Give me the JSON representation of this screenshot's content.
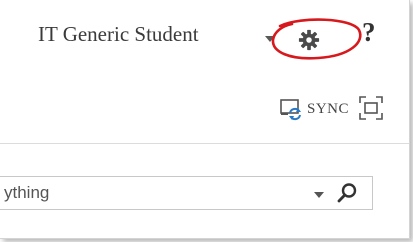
{
  "header": {
    "user_name": "IT Generic Student",
    "user_menu_icon": "chevron-down-icon",
    "settings_icon": "gear-icon",
    "help_label": "?"
  },
  "toolbar": {
    "sync_label": "SYNC",
    "sync_icon": "sync-icon",
    "focus_icon": "focus-mode-icon"
  },
  "search": {
    "value": "ything",
    "scope_icon": "chevron-down-icon",
    "search_icon": "search-icon"
  },
  "colors": {
    "highlight": "#d7191d",
    "text": "#3a3a3a",
    "icon": "#444444",
    "sync_accent": "#2b78c5"
  }
}
